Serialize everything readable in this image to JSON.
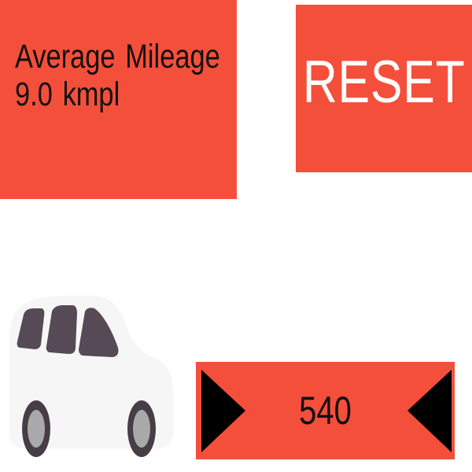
{
  "mileage": {
    "label": "Average Mileage",
    "value": "9.0 kmpl"
  },
  "reset": {
    "label": "RESET"
  },
  "counter": {
    "value": "540",
    "increase_icon": "right-triangle-icon",
    "decrease_icon": "left-triangle-icon"
  },
  "car": {
    "icon": "car-icon"
  },
  "colors": {
    "panel": "#f44f3b",
    "text_dark": "#111111",
    "text_light": "#ffffff",
    "car_body": "#f7f6f6",
    "car_window": "#564a56",
    "tire": "#463d46",
    "hubcap": "#a9a9a9"
  }
}
